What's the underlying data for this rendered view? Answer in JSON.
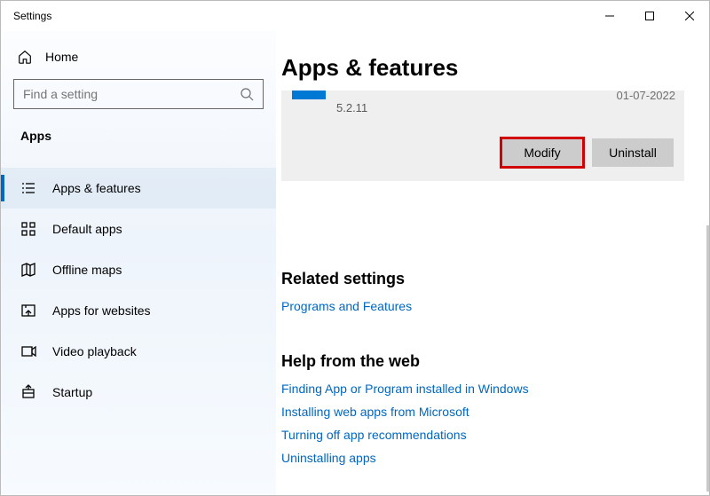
{
  "window": {
    "title": "Settings"
  },
  "sidebar": {
    "home_label": "Home",
    "search_placeholder": "Find a setting",
    "section_label": "Apps",
    "items": [
      {
        "label": "Apps & features"
      },
      {
        "label": "Default apps"
      },
      {
        "label": "Offline maps"
      },
      {
        "label": "Apps for websites"
      },
      {
        "label": "Video playback"
      },
      {
        "label": "Startup"
      }
    ]
  },
  "page": {
    "title": "Apps & features",
    "app": {
      "version": "5.2.11",
      "date": "01-07-2022",
      "modify_label": "Modify",
      "uninstall_label": "Uninstall"
    },
    "related": {
      "heading": "Related settings",
      "links": [
        "Programs and Features"
      ]
    },
    "help": {
      "heading": "Help from the web",
      "links": [
        "Finding App or Program installed in Windows",
        "Installing web apps from Microsoft",
        "Turning off app recommendations",
        "Uninstalling apps"
      ]
    }
  }
}
